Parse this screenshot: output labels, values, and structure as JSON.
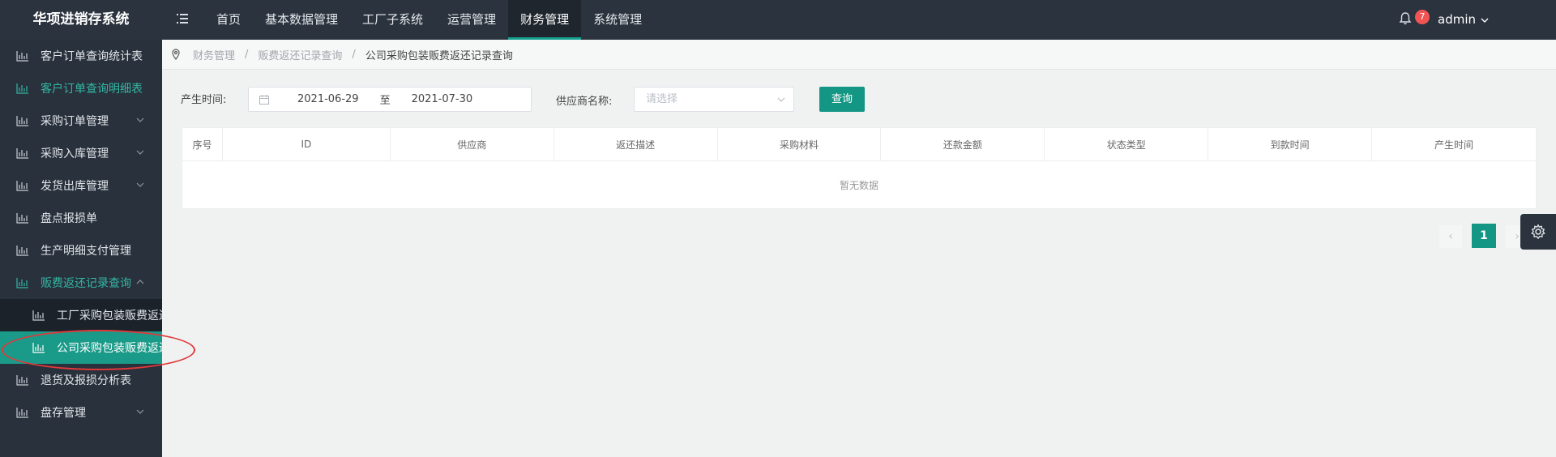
{
  "brand": "华项进销存系统",
  "colors": {
    "accent": "#149684",
    "topbar": "#2b333e",
    "sidebar": "#28313c",
    "badge": "#f25454",
    "annotation": "#e0393b"
  },
  "topnav": {
    "toggle_icon": "menu-icon",
    "items": [
      {
        "label": "首页"
      },
      {
        "label": "基本数据管理"
      },
      {
        "label": "工厂子系统"
      },
      {
        "label": "运营管理"
      },
      {
        "label": "财务管理",
        "active": true
      },
      {
        "label": "系统管理"
      }
    ],
    "notification_count": "7",
    "user": "admin"
  },
  "sidebar": {
    "items": [
      {
        "label": "客户订单查询统计表"
      },
      {
        "label": "客户订单查询明细表"
      },
      {
        "label": "采购订单管理"
      },
      {
        "label": "采购入库管理"
      },
      {
        "label": "发货出库管理"
      },
      {
        "label": "盘点报损单"
      },
      {
        "label": "生产明细支付管理"
      },
      {
        "label": "贩费返还记录查询"
      },
      {
        "label": "退货及报损分析表"
      },
      {
        "label": "盘存管理"
      }
    ],
    "sub_items": [
      {
        "label": "工厂采购包装贩费返还"
      },
      {
        "label": "公司采购包装贩费返还"
      }
    ]
  },
  "breadcrumb": {
    "items": [
      "财务管理",
      "贩费返还记录查询",
      "公司采购包装贩费返还记录查询"
    ],
    "separator": "/"
  },
  "filter": {
    "time_label": "产生时间:",
    "date_start": "2021-06-29",
    "date_sep": "至",
    "date_end": "2021-07-30",
    "supplier_label": "供应商名称:",
    "supplier_placeholder": "请选择",
    "query_button": "查询"
  },
  "table": {
    "columns": [
      "序号",
      "ID",
      "供应商",
      "返还描述",
      "采购材料",
      "还款金额",
      "状态类型",
      "到款时间",
      "产生时间"
    ],
    "empty_text": "暂无数据"
  },
  "pagination": {
    "prev": "‹",
    "current_page": "1",
    "next": "›"
  }
}
